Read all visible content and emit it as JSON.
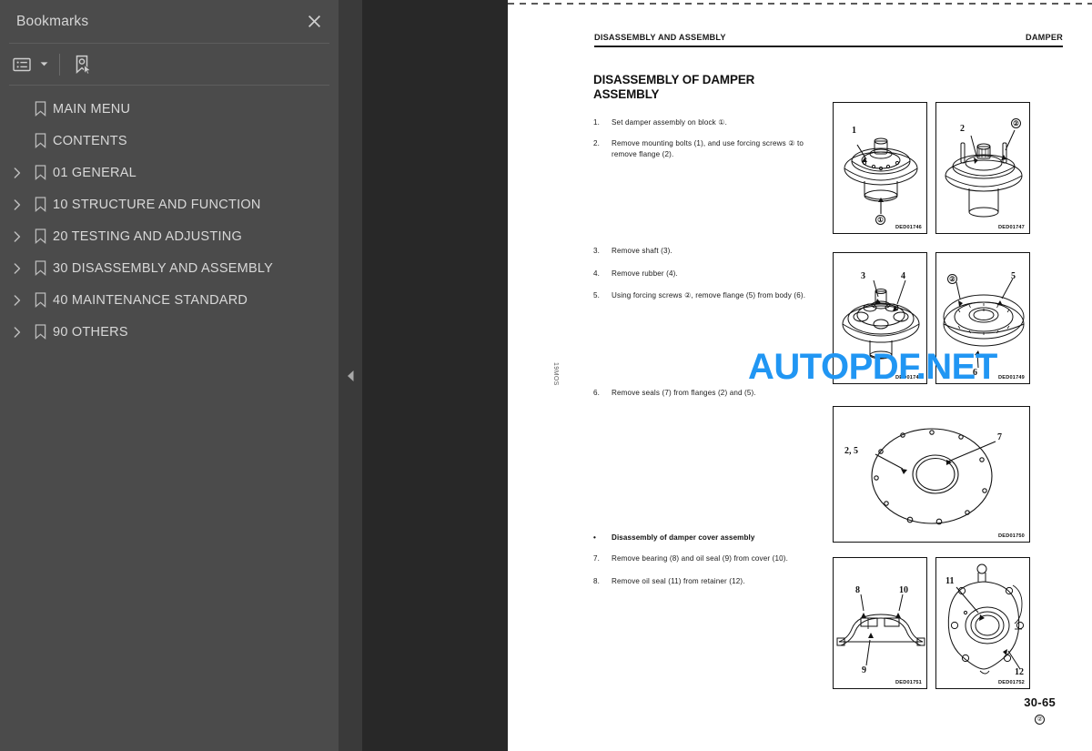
{
  "sidebar": {
    "title": "Bookmarks",
    "close_label": "×",
    "toolbar": {
      "list_options_label": "List options",
      "list_options_icon": "list-view-icon",
      "dropdown_icon": "chevron-down-icon",
      "new_bookmark_label": "New bookmark",
      "new_bookmark_icon": "bookmark-pointer-icon"
    },
    "items": [
      {
        "label": "MAIN MENU",
        "expandable": false
      },
      {
        "label": "CONTENTS",
        "expandable": false
      },
      {
        "label": "01 GENERAL",
        "expandable": true
      },
      {
        "label": "10 STRUCTURE AND FUNCTION",
        "expandable": true
      },
      {
        "label": "20 TESTING AND ADJUSTING",
        "expandable": true
      },
      {
        "label": "30 DISASSEMBLY AND ASSEMBLY",
        "expandable": true
      },
      {
        "label": "40 MAINTENANCE STANDARD",
        "expandable": true
      },
      {
        "label": "90 OTHERS",
        "expandable": true
      }
    ]
  },
  "splitter": {
    "collapse_icon": "triangle-left-icon",
    "collapse_label": "Collapse panel"
  },
  "watermark": {
    "text": "AUTOPDF.NET",
    "color": "#2196f3"
  },
  "document": {
    "header_left": "DISASSEMBLY AND ASSEMBLY",
    "header_right": "DAMPER",
    "margin_text": "19MOS",
    "title": "DISASSEMBLY OF DAMPER ASSEMBLY",
    "steps": [
      {
        "num": "1.",
        "text": "Set damper assembly on block ①."
      },
      {
        "num": "2.",
        "text": "Remove mounting bolts (1), and use forcing screws ② to remove flange (2)."
      },
      {
        "num": "3.",
        "text": "Remove shaft (3)."
      },
      {
        "num": "4.",
        "text": "Remove rubber (4)."
      },
      {
        "num": "5.",
        "text": "Using forcing screws ②, remove flange (5) from body (6)."
      },
      {
        "num": "6.",
        "text": "Remove seals (7) from flanges (2) and (5)."
      }
    ],
    "subsection": {
      "bullet": "•",
      "heading": "Disassembly of damper cover assembly",
      "steps": [
        {
          "num": "7.",
          "text": "Remove bearing (8) and oil seal (9) from cover (10)."
        },
        {
          "num": "8.",
          "text": "Remove oil seal (11) from retainer (12)."
        }
      ]
    },
    "figures": [
      {
        "id": "DED01746",
        "callouts": [
          "1",
          "①"
        ]
      },
      {
        "id": "DED01747",
        "callouts": [
          "2",
          "②"
        ]
      },
      {
        "id": "DED01748",
        "callouts": [
          "3",
          "4"
        ]
      },
      {
        "id": "DED01749",
        "callouts": [
          "②",
          "5",
          "6"
        ]
      },
      {
        "id": "DED01750",
        "callouts": [
          "2, 5",
          "7"
        ]
      },
      {
        "id": "DED01751",
        "callouts": [
          "8",
          "10",
          "9"
        ]
      },
      {
        "id": "DED01752",
        "callouts": [
          "11",
          "12"
        ]
      }
    ],
    "page_number": "30-65",
    "page_number_mark": "②"
  }
}
